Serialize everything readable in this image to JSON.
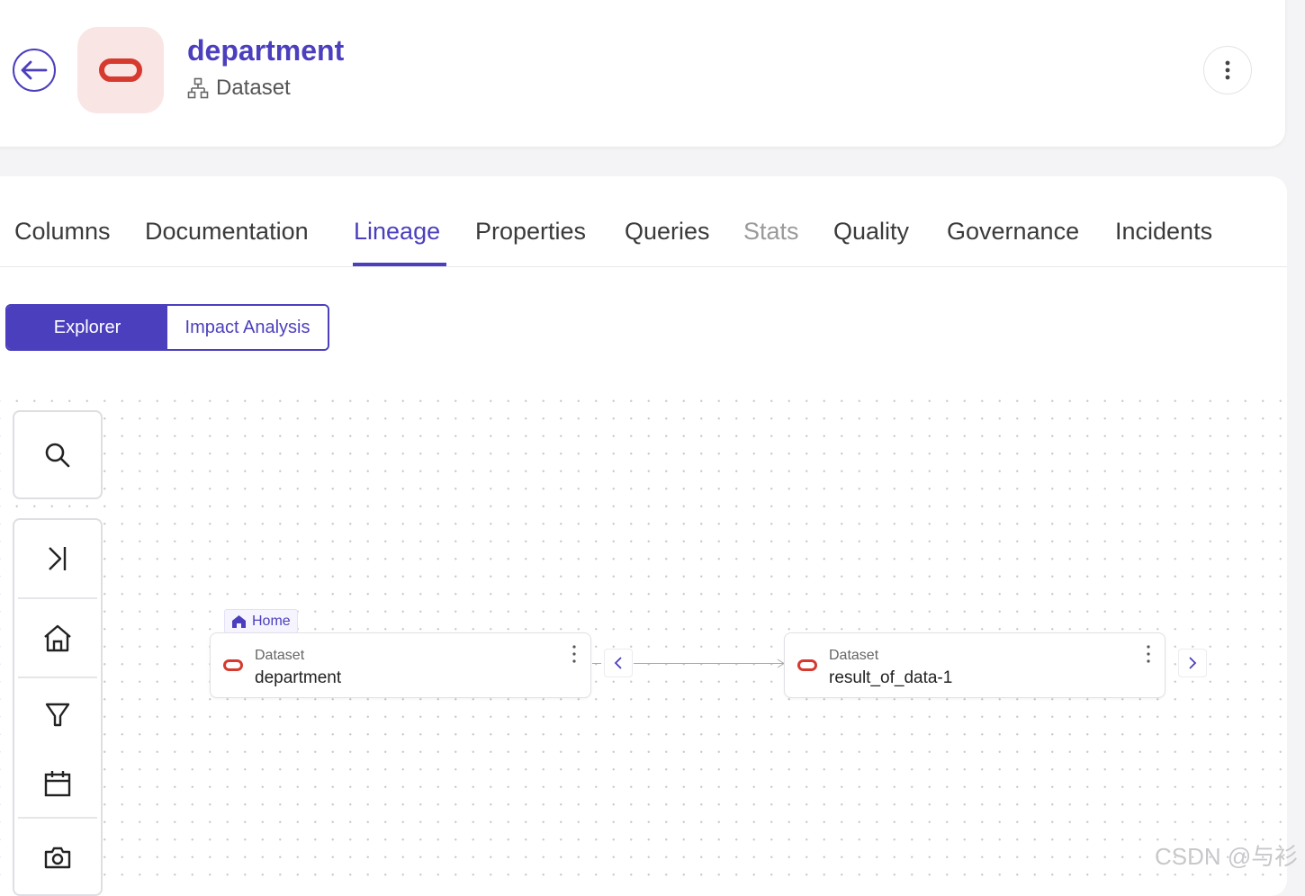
{
  "header": {
    "title": "department",
    "entity_type": "Dataset",
    "back_icon": "arrow-left-icon",
    "more_icon": "vertical-dots-icon"
  },
  "tabs": [
    {
      "label": "Columns",
      "state": "normal"
    },
    {
      "label": "Documentation",
      "state": "normal"
    },
    {
      "label": "Lineage",
      "state": "active"
    },
    {
      "label": "Properties",
      "state": "normal"
    },
    {
      "label": "Queries",
      "state": "normal"
    },
    {
      "label": "Stats",
      "state": "disabled"
    },
    {
      "label": "Quality",
      "state": "normal"
    },
    {
      "label": "Governance",
      "state": "normal"
    },
    {
      "label": "Incidents",
      "state": "normal"
    }
  ],
  "view_toggle": {
    "explorer": "Explorer",
    "impact": "Impact Analysis",
    "selected": "Explorer"
  },
  "toolbar": {
    "icons": [
      "search-icon",
      "expand-to-end-icon",
      "home-icon",
      "filter-icon",
      "calendar-icon",
      "camera-icon"
    ]
  },
  "lineage": {
    "home_tag": "Home",
    "nodes": [
      {
        "type": "Dataset",
        "name": "department"
      },
      {
        "type": "Dataset",
        "name": "result_of_data-1"
      }
    ]
  },
  "colors": {
    "accent": "#4b3fbd",
    "oracle_red": "#d63a2f",
    "logo_bg": "#f9e5e4"
  },
  "watermark": "CSDN @与衫"
}
